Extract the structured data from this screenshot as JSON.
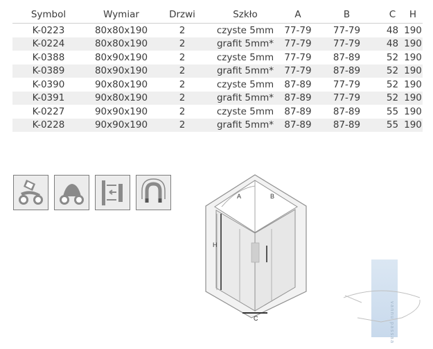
{
  "table": {
    "headers": [
      "Symbol",
      "Wymiar",
      "Drzwi",
      "Szkło",
      "A",
      "B",
      "C",
      "H"
    ],
    "rows": [
      [
        "K-0223",
        "80x80x190",
        "2",
        "czyste 5mm",
        "77-79",
        "77-79",
        "48",
        "190"
      ],
      [
        "K-0224",
        "80x80x190",
        "2",
        "grafit 5mm*",
        "77-79",
        "77-79",
        "48",
        "190"
      ],
      [
        "K-0388",
        "80x90x190",
        "2",
        "czyste 5mm",
        "77-79",
        "87-89",
        "52",
        "190"
      ],
      [
        "K-0389",
        "80x90x190",
        "2",
        "grafit 5mm*",
        "77-79",
        "87-89",
        "52",
        "190"
      ],
      [
        "K-0390",
        "90x80x190",
        "2",
        "czyste 5mm",
        "87-89",
        "77-79",
        "52",
        "190"
      ],
      [
        "K-0391",
        "90x80x190",
        "2",
        "grafit 5mm*",
        "87-89",
        "77-79",
        "52",
        "190"
      ],
      [
        "K-0227",
        "90x90x190",
        "2",
        "czyste 5mm",
        "87-89",
        "87-89",
        "55",
        "190"
      ],
      [
        "K-0228",
        "90x90x190",
        "2",
        "grafit 5mm*",
        "87-89",
        "87-89",
        "55",
        "190"
      ]
    ]
  },
  "icons": [
    {
      "name": "wheels-tilted-icon"
    },
    {
      "name": "wheels-icon"
    },
    {
      "name": "wall-mount-profile-icon"
    },
    {
      "name": "magnet-icon"
    }
  ],
  "diagram": {
    "label_a": "A",
    "label_b": "B",
    "label_h": "H",
    "label_c": "C"
  },
  "watermark": {
    "text": "vannu passaa"
  }
}
